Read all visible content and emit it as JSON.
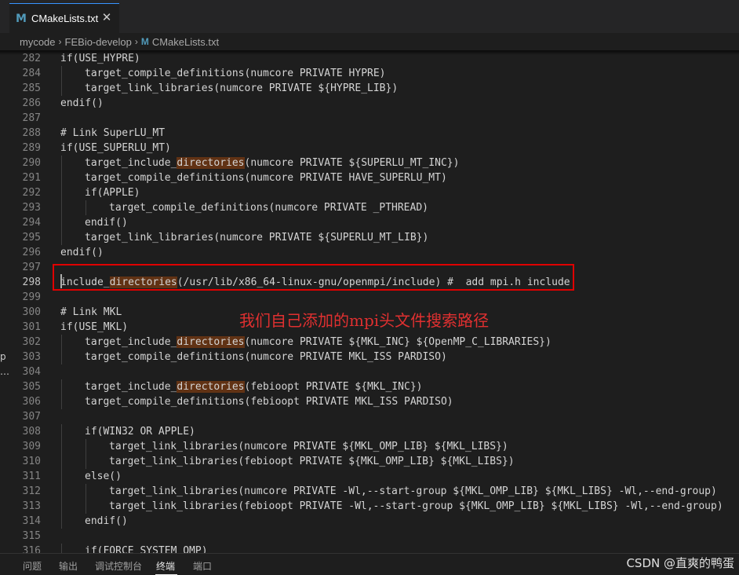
{
  "tab": {
    "icon": "M",
    "label": "CMakeLists.txt",
    "close": "✕"
  },
  "breadcrumb": [
    "mycode",
    "FEBio-develop",
    "CMakeLists.txt"
  ],
  "editor": {
    "lines": [
      {
        "num": "282",
        "indent": 0,
        "parts": [
          {
            "t": "if(USE_HYPRE)"
          }
        ]
      },
      {
        "num": "284",
        "indent": 1,
        "parts": [
          {
            "t": "target_compile_definitions(numcore PRIVATE HYPRE)"
          }
        ]
      },
      {
        "num": "285",
        "indent": 1,
        "parts": [
          {
            "t": "target_link_libraries(numcore PRIVATE ${HYPRE_LIB})"
          }
        ]
      },
      {
        "num": "286",
        "indent": 0,
        "parts": [
          {
            "t": "endif()"
          }
        ]
      },
      {
        "num": "287",
        "indent": 0,
        "parts": []
      },
      {
        "num": "288",
        "indent": 0,
        "parts": [
          {
            "t": "# Link SuperLU_MT"
          }
        ]
      },
      {
        "num": "289",
        "indent": 0,
        "parts": [
          {
            "t": "if(USE_SUPERLU_MT)"
          }
        ]
      },
      {
        "num": "290",
        "indent": 1,
        "parts": [
          {
            "t": "target_include_"
          },
          {
            "t": "directories",
            "hl": true
          },
          {
            "t": "(numcore PRIVATE ${SUPERLU_MT_INC})"
          }
        ]
      },
      {
        "num": "291",
        "indent": 1,
        "parts": [
          {
            "t": "target_compile_definitions(numcore PRIVATE HAVE_SUPERLU_MT)"
          }
        ]
      },
      {
        "num": "292",
        "indent": 1,
        "parts": [
          {
            "t": "if(APPLE)"
          }
        ]
      },
      {
        "num": "293",
        "indent": 2,
        "parts": [
          {
            "t": "target_compile_definitions(numcore PRIVATE _PTHREAD)"
          }
        ]
      },
      {
        "num": "294",
        "indent": 1,
        "parts": [
          {
            "t": "endif()"
          }
        ]
      },
      {
        "num": "295",
        "indent": 1,
        "parts": [
          {
            "t": "target_link_libraries(numcore PRIVATE ${SUPERLU_MT_LIB})"
          }
        ]
      },
      {
        "num": "296",
        "indent": 0,
        "parts": [
          {
            "t": "endif()"
          }
        ]
      },
      {
        "num": "297",
        "indent": 0,
        "parts": []
      },
      {
        "num": "298",
        "indent": 0,
        "active": true,
        "parts": [
          {
            "t": "include_"
          },
          {
            "t": "directories",
            "hl": true
          },
          {
            "t": "(/usr/lib/x86_64-linux-gnu/openmpi/include) #  add mpi.h include"
          }
        ]
      },
      {
        "num": "299",
        "indent": 0,
        "parts": []
      },
      {
        "num": "300",
        "indent": 0,
        "parts": [
          {
            "t": "# Link MKL"
          }
        ]
      },
      {
        "num": "301",
        "indent": 0,
        "parts": [
          {
            "t": "if(USE_MKL)"
          }
        ]
      },
      {
        "num": "302",
        "indent": 1,
        "parts": [
          {
            "t": "target_include_"
          },
          {
            "t": "directories",
            "hl": true
          },
          {
            "t": "(numcore PRIVATE ${MKL_INC} ${OpenMP_C_LIBRARIES})"
          }
        ]
      },
      {
        "num": "303",
        "indent": 1,
        "parts": [
          {
            "t": "target_compile_definitions(numcore PRIVATE MKL_ISS PARDISO)"
          }
        ]
      },
      {
        "num": "304",
        "indent": 0,
        "parts": []
      },
      {
        "num": "305",
        "indent": 1,
        "parts": [
          {
            "t": "target_include_"
          },
          {
            "t": "directories",
            "hl": true
          },
          {
            "t": "(febioopt PRIVATE ${MKL_INC})"
          }
        ]
      },
      {
        "num": "306",
        "indent": 1,
        "parts": [
          {
            "t": "target_compile_definitions(febioopt PRIVATE MKL_ISS PARDISO)"
          }
        ]
      },
      {
        "num": "307",
        "indent": 0,
        "parts": []
      },
      {
        "num": "308",
        "indent": 1,
        "parts": [
          {
            "t": "if(WIN32 OR APPLE)"
          }
        ]
      },
      {
        "num": "309",
        "indent": 2,
        "parts": [
          {
            "t": "target_link_libraries(numcore PRIVATE ${MKL_OMP_LIB} ${MKL_LIBS})"
          }
        ]
      },
      {
        "num": "310",
        "indent": 2,
        "parts": [
          {
            "t": "target_link_libraries(febioopt PRIVATE ${MKL_OMP_LIB} ${MKL_LIBS})"
          }
        ]
      },
      {
        "num": "311",
        "indent": 1,
        "parts": [
          {
            "t": "else()"
          }
        ]
      },
      {
        "num": "312",
        "indent": 2,
        "parts": [
          {
            "t": "target_link_libraries(numcore PRIVATE -Wl,--start-group ${MKL_OMP_LIB} ${MKL_LIBS} -Wl,--end-group)"
          }
        ]
      },
      {
        "num": "313",
        "indent": 2,
        "parts": [
          {
            "t": "target_link_libraries(febioopt PRIVATE -Wl,--start-group ${MKL_OMP_LIB} ${MKL_LIBS} -Wl,--end-group)"
          }
        ]
      },
      {
        "num": "314",
        "indent": 1,
        "parts": [
          {
            "t": "endif()"
          }
        ]
      },
      {
        "num": "315",
        "indent": 0,
        "parts": []
      },
      {
        "num": "316",
        "indent": 1,
        "parts": [
          {
            "t": "if(FORCE_SYSTEM_OMP)"
          }
        ]
      }
    ]
  },
  "annotation": {
    "text": "我们自己添加的mpi头文件搜索路径",
    "color": "#e00000"
  },
  "left_fragments": [
    "p",
    "…"
  ],
  "panel": {
    "tabs": [
      {
        "label": "问题",
        "active": false
      },
      {
        "label": "输出",
        "active": false
      },
      {
        "label": "调试控制台",
        "active": false
      },
      {
        "label": "终端",
        "active": true
      },
      {
        "label": "端口",
        "active": false
      }
    ]
  },
  "watermark": "CSDN @直爽的鸭蛋",
  "colors": {
    "background": "#1e1e1e",
    "accent": "#3794ff",
    "highlight": "#613214"
  }
}
